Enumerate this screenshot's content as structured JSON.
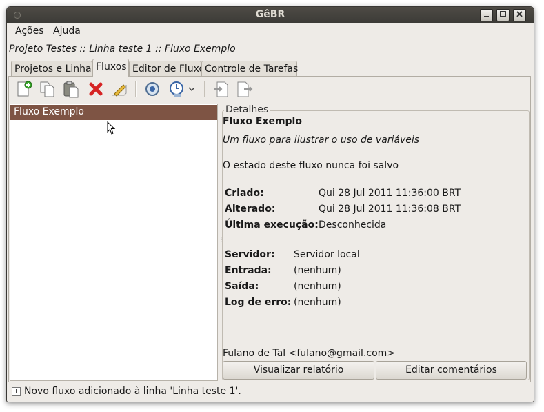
{
  "window": {
    "title": "GêBR"
  },
  "menubar": {
    "items": [
      {
        "mnemonic": "A",
        "rest": "ções"
      },
      {
        "mnemonic": "A",
        "rest": "juda"
      }
    ]
  },
  "breadcrumb": "Projeto Testes :: Linha teste 1 :: Fluxo Exemplo",
  "tabs": [
    "Projetos e Linhas",
    "Fluxos",
    "Editor de Fluxo",
    "Controle de Tarefas"
  ],
  "active_tab": "Fluxos",
  "toolbar": {
    "icons": [
      "new-flow-icon",
      "copy-icon",
      "paste-icon",
      "delete-icon",
      "edit-properties-icon",
      "execute-icon",
      "schedule-icon",
      "dropdown-icon",
      "import-icon",
      "export-icon"
    ]
  },
  "flow_list": {
    "items": [
      "Fluxo Exemplo"
    ]
  },
  "details": {
    "legend": "Detalhes",
    "title": "Fluxo Exemplo",
    "description": "Um fluxo para ilustrar o uso de variáveis",
    "state": "O estado deste fluxo nunca foi salvo",
    "created_label": "Criado:",
    "created_value": "Qui 28 Jul 2011 11:36:00 BRT",
    "modified_label": "Alterado:",
    "modified_value": "Qui 28 Jul 2011 11:36:08 BRT",
    "last_exec_label": "Última execução:",
    "last_exec_value": "Desconhecida",
    "server_label": "Servidor:",
    "server_value": "Servidor local",
    "input_label": "Entrada:",
    "input_value": "(nenhum)",
    "output_label": "Saída:",
    "output_value": "(nenhum)",
    "errorlog_label": "Log de erro:",
    "errorlog_value": "(nenhum)",
    "author": "Fulano de Tal <fulano@gmail.com>",
    "view_report_button": "Visualizar relatório",
    "edit_comments_button": "Editar comentários"
  },
  "statusbar": {
    "expander": "+",
    "message": "Novo fluxo adicionado à linha 'Linha teste 1'."
  },
  "colors": {
    "selection": "#7e5444",
    "titlebar": "#3c3b37",
    "window_bg": "#eeebe7"
  }
}
